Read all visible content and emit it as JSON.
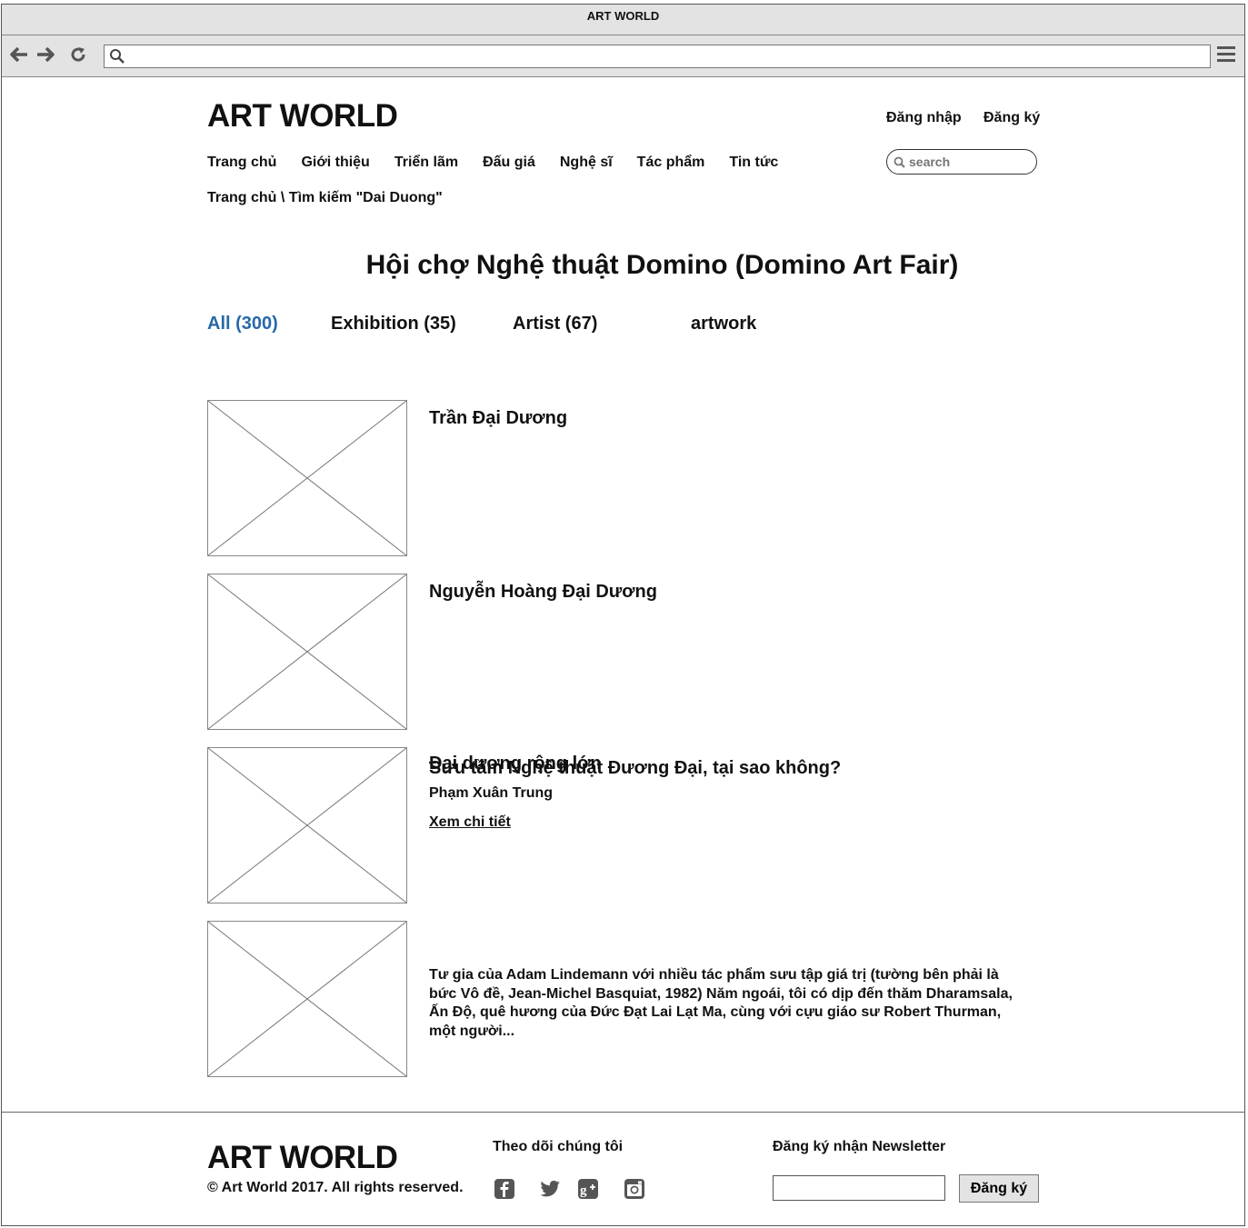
{
  "browser": {
    "window_title": "ART WORLD",
    "url": ""
  },
  "header": {
    "logo": "ART WORLD",
    "login": "Đăng nhập",
    "register": "Đăng ký",
    "search_placeholder": "search",
    "nav": [
      "Trang chủ",
      "Giới thiệu",
      "Triển lãm",
      "Đấu giá",
      "Nghệ sĩ",
      "Tác phẩm",
      "Tin tức"
    ]
  },
  "breadcrumb": "Trang chủ \\ Tìm kiếm \"Dai Duong\"",
  "page_title": "Hội chợ Nghệ thuật Domino (Domino Art Fair)",
  "tabs": [
    {
      "label": "All (300)",
      "active": true
    },
    {
      "label": "Exhibition (35)",
      "active": false
    },
    {
      "label": "Artist (67)",
      "active": false
    },
    {
      "label": "artwork",
      "active": false
    }
  ],
  "results": [
    {
      "title": "Trần Đại Dương"
    },
    {
      "title": "Nguyễn Hoàng Đại Dương"
    },
    {
      "title_overlap": "Đại dương rộng lớn",
      "title": "Sưu tầm Nghệ thuật Đương Đại, tại sao không?",
      "author": "Phạm Xuân Trung",
      "link": "Xem chi tiết"
    },
    {
      "description": "Tư gia của Adam Lindemann với nhiều tác phẩm sưu tập giá trị (tường bên phải là bức Vô đề, Jean-Michel Basquiat, 1982) Năm ngoái, tôi có dịp đến thăm Dharamsala, Ấn Độ, quê hương của Đức Đạt Lai Lạt Ma, cùng với cựu giáo sư Robert Thurman, một người..."
    }
  ],
  "footer": {
    "logo": "ART WORLD",
    "copyright": "© Art World 2017. All rights reserved.",
    "follow_heading": "Theo dõi chúng tôi",
    "social_icons": [
      "facebook-icon",
      "twitter-icon",
      "google-plus-icon",
      "instagram-icon"
    ],
    "newsletter_heading": "Đăng ký nhận Newsletter",
    "newsletter_value": "",
    "newsletter_button": "Đăng ký"
  }
}
